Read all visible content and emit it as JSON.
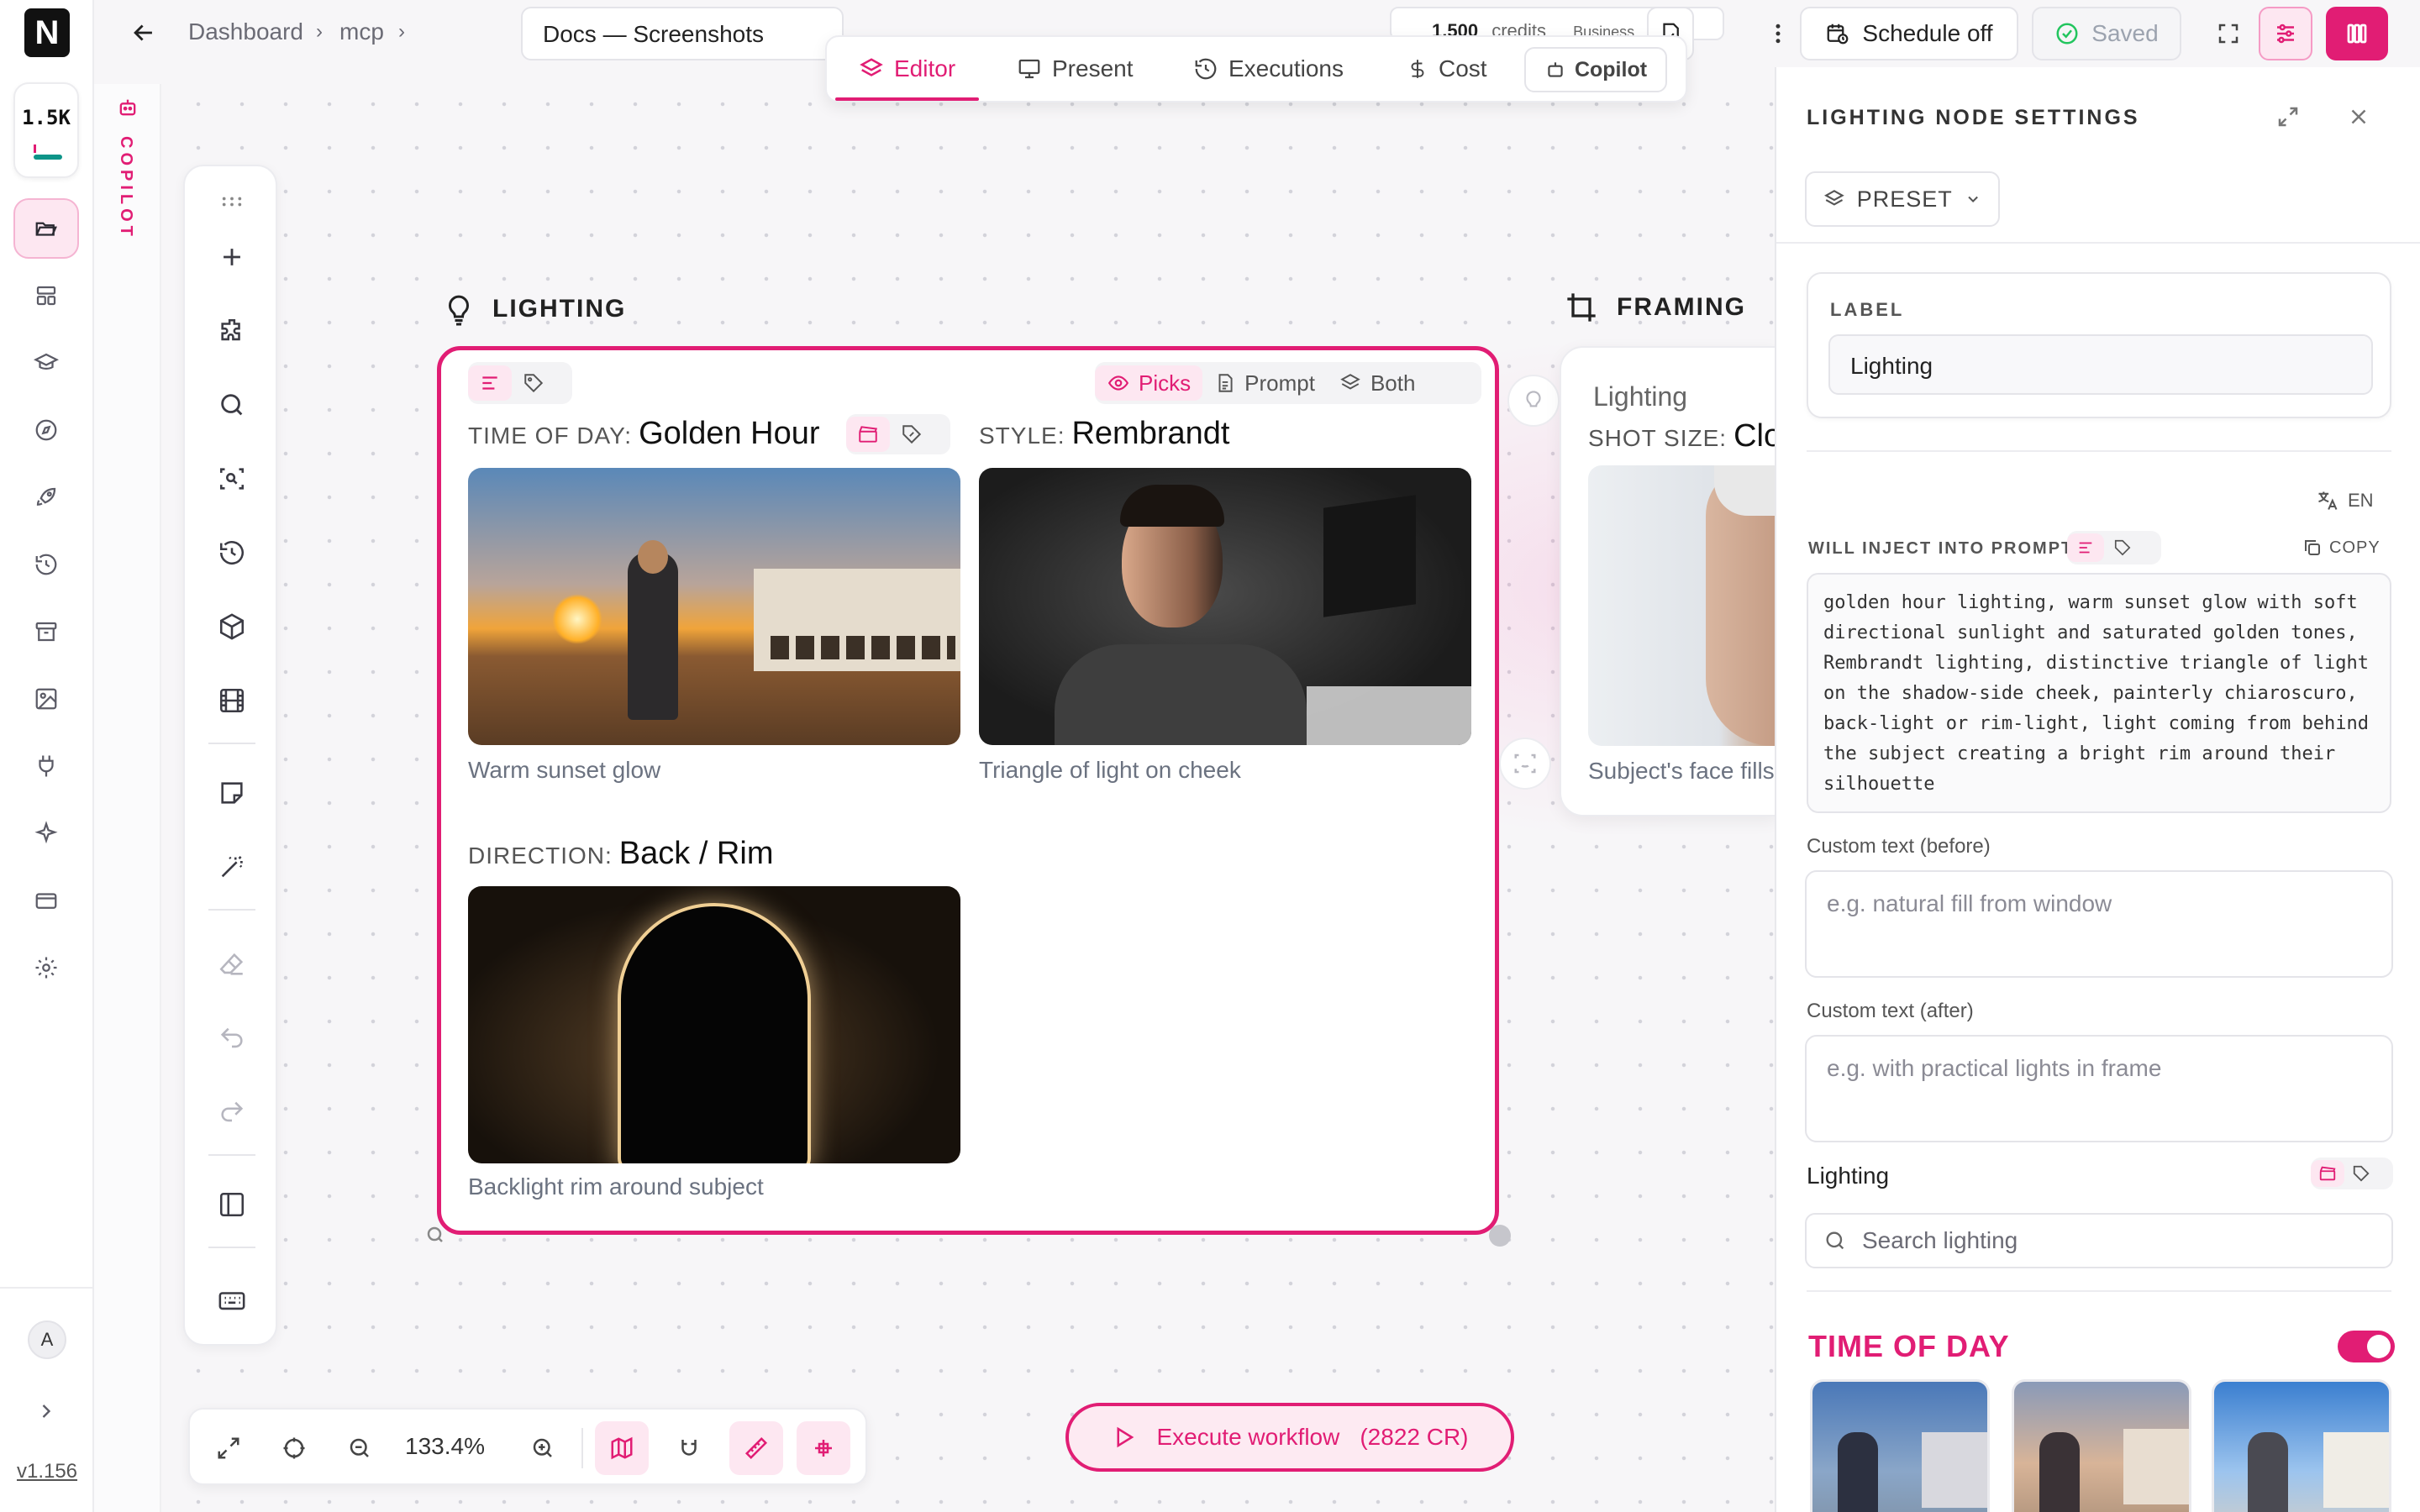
{
  "app": {
    "logo_letter": "N",
    "credits_badge": "1.5K",
    "version": "v1.156",
    "avatar_initial": "A"
  },
  "copilot_strip": {
    "label": "COPILOT"
  },
  "breadcrumb": {
    "items": [
      "Dashboard",
      "mcp"
    ],
    "separator": "›"
  },
  "document_title": "Docs — Screenshots",
  "tabs": [
    {
      "label": "Editor",
      "icon": "layers-icon",
      "active": true
    },
    {
      "label": "Present",
      "icon": "monitor-icon"
    },
    {
      "label": "Executions",
      "icon": "history-icon"
    },
    {
      "label": "Cost",
      "icon": "dollar-icon"
    }
  ],
  "copilot_chip": "Copilot",
  "credit_pill": {
    "amount": "1,500",
    "unit": "credits",
    "plan": "Business"
  },
  "toolbar": {
    "schedule_label": "Schedule off",
    "saved_label": "Saved"
  },
  "canvas": {
    "zoom": "133.4%",
    "execute_label": "Execute workflow",
    "execute_cost": "(2822 CR)"
  },
  "lighting_node": {
    "section_title": "LIGHTING",
    "view_modes": [
      "Picks",
      "Prompt",
      "Both"
    ],
    "active_mode": "Picks",
    "picks": [
      {
        "label": "TIME OF DAY:",
        "value": "Golden Hour",
        "caption": "Warm sunset glow"
      },
      {
        "label": "STYLE:",
        "value": "Rembrandt",
        "caption": "Triangle of light on cheek"
      },
      {
        "label": "DIRECTION:",
        "value": "Back / Rim",
        "caption": "Backlight rim around subject"
      }
    ]
  },
  "framing_node": {
    "section_title": "FRAMING",
    "header": "Lighting",
    "label": "SHOT SIZE:",
    "value": "Close-up",
    "caption": "Subject's face fills the frame"
  },
  "panel": {
    "title": "LIGHTING NODE SETTINGS",
    "preset_label": "PRESET",
    "label_caption": "LABEL",
    "label_value": "Lighting",
    "lang": "EN",
    "inject_caption": "WILL INJECT INTO PROMPT",
    "copy_label": "COPY",
    "prompt_text": "golden hour lighting, warm sunset glow with soft\ndirectional sunlight and saturated golden tones,\nRembrandt lighting, distinctive triangle of light\non the shadow-side cheek, painterly chiaroscuro,\nback-light or rim-light, light coming from behind\nthe subject creating a bright rim around their\nsilhouette",
    "custom_before_label": "Custom text (before)",
    "custom_before_placeholder": "e.g. natural fill from window",
    "custom_after_label": "Custom text (after)",
    "custom_after_placeholder": "e.g. with practical lights in frame",
    "category_label": "Lighting",
    "search_placeholder": "Search lighting",
    "time_of_day_title": "TIME OF DAY",
    "time_of_day_enabled": true
  },
  "colors": {
    "accent": "#e11d74",
    "accent_soft": "#fde7f1",
    "saved_check": "#22c55e"
  }
}
